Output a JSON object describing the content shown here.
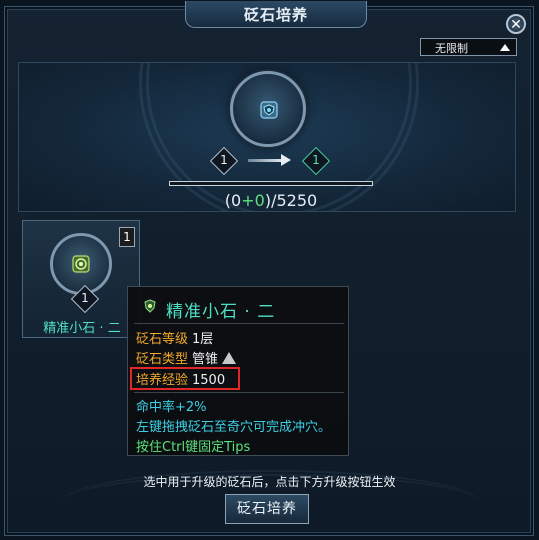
{
  "window": {
    "title": "砭石培养",
    "close_glyph": "✕"
  },
  "filter": {
    "selected": "无限制"
  },
  "upgrade": {
    "level_from": "1",
    "level_to": "1",
    "exp_current": "0",
    "exp_added": "+0",
    "exp_total": "5250",
    "progress": 0
  },
  "slot": {
    "count": "1",
    "level": "1",
    "name": "精准小石 · 二"
  },
  "tooltip": {
    "name": "精准小石 · 二",
    "level_label": "砭石等级",
    "level_value": "1层",
    "type_label": "砭石类型",
    "type_value": "管锥",
    "exp_label": "培养经验",
    "exp_value": "1500",
    "effect": "命中率+2%",
    "usage": "左键拖拽砭石至奇穴可完成冲穴。",
    "tip": "按住Ctrl键固定Tips"
  },
  "footer": {
    "hint": "选中用于升级的砭石后，点击下方升级按钮生效",
    "button_label": "砭石培养"
  },
  "colors": {
    "gem_name": "#4fe0c4",
    "label_orange": "#f2a92b",
    "effect_cyan": "#3ccfe4",
    "tip_green": "#5ee07a",
    "highlight_red": "#e02626"
  }
}
